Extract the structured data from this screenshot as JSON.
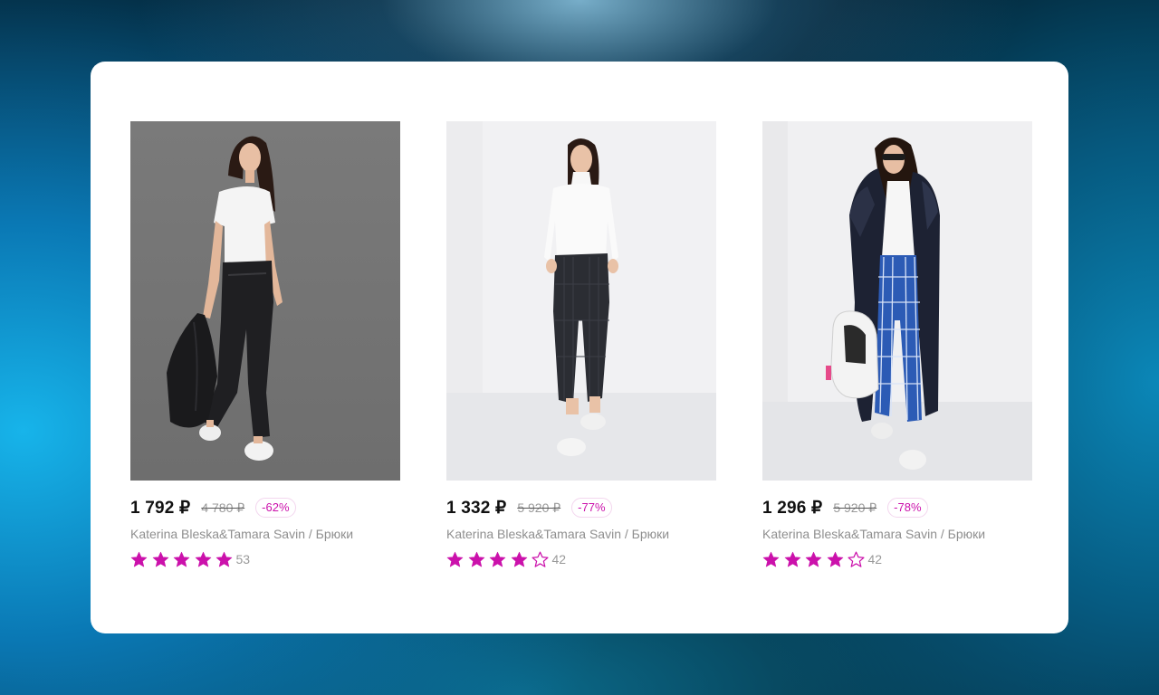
{
  "colors": {
    "accent": "#cb11ab",
    "price": "#111111",
    "muted": "#8f8f8f"
  },
  "products": [
    {
      "image_icon": "model-black-trousers-photo",
      "price": "1 792 ₽",
      "old_price": "4 780 ₽",
      "discount": "-62%",
      "title": "Katerina Bleska&Tamara Savin / Брюки",
      "rating": 5,
      "reviews": "53"
    },
    {
      "image_icon": "model-plaid-grey-trousers-photo",
      "price": "1 332 ₽",
      "old_price": "5 920 ₽",
      "discount": "-77%",
      "title": "Katerina Bleska&Tamara Savin / Брюки",
      "rating": 4,
      "reviews": "42"
    },
    {
      "image_icon": "model-blue-check-trousers-photo",
      "price": "1 296 ₽",
      "old_price": "5 920 ₽",
      "discount": "-78%",
      "title": "Katerina Bleska&Tamara Savin / Брюки",
      "rating": 4,
      "reviews": "42"
    }
  ]
}
